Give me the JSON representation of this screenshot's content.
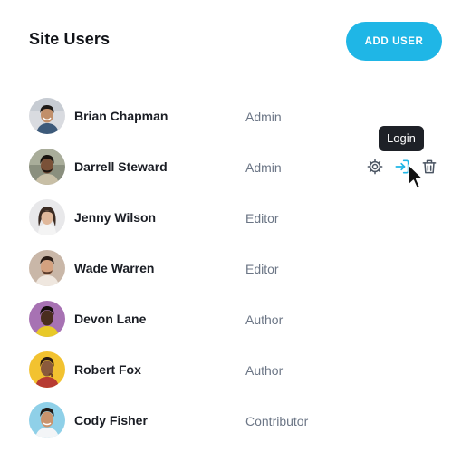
{
  "header": {
    "title": "Site Users",
    "add_user_label": "ADD USER"
  },
  "colors": {
    "accent": "#1fb6e6",
    "text_primary": "#1a1d24",
    "text_secondary": "#6c7686",
    "icon_gray": "#4b5563",
    "tooltip_bg": "#1e2127"
  },
  "users": [
    {
      "name": "Brian Chapman",
      "role": "Admin",
      "avatar_bg": "#d9dbe0"
    },
    {
      "name": "Darrell Steward",
      "role": "Admin",
      "avatar_bg": "#8a8f7e"
    },
    {
      "name": "Jenny Wilson",
      "role": "Editor",
      "avatar_bg": "#e8e8ea"
    },
    {
      "name": "Wade Warren",
      "role": "Editor",
      "avatar_bg": "#c9b7a8"
    },
    {
      "name": "Devon Lane",
      "role": "Author",
      "avatar_bg": "#a772b3"
    },
    {
      "name": "Robert Fox",
      "role": "Author",
      "avatar_bg": "#f2c230"
    },
    {
      "name": "Cody Fisher",
      "role": "Contributor",
      "avatar_bg": "#8fd0e8"
    }
  ],
  "row_actions": {
    "icons": [
      "gear-icon",
      "login-icon",
      "trash-icon"
    ]
  },
  "tooltip": {
    "text": "Login"
  }
}
